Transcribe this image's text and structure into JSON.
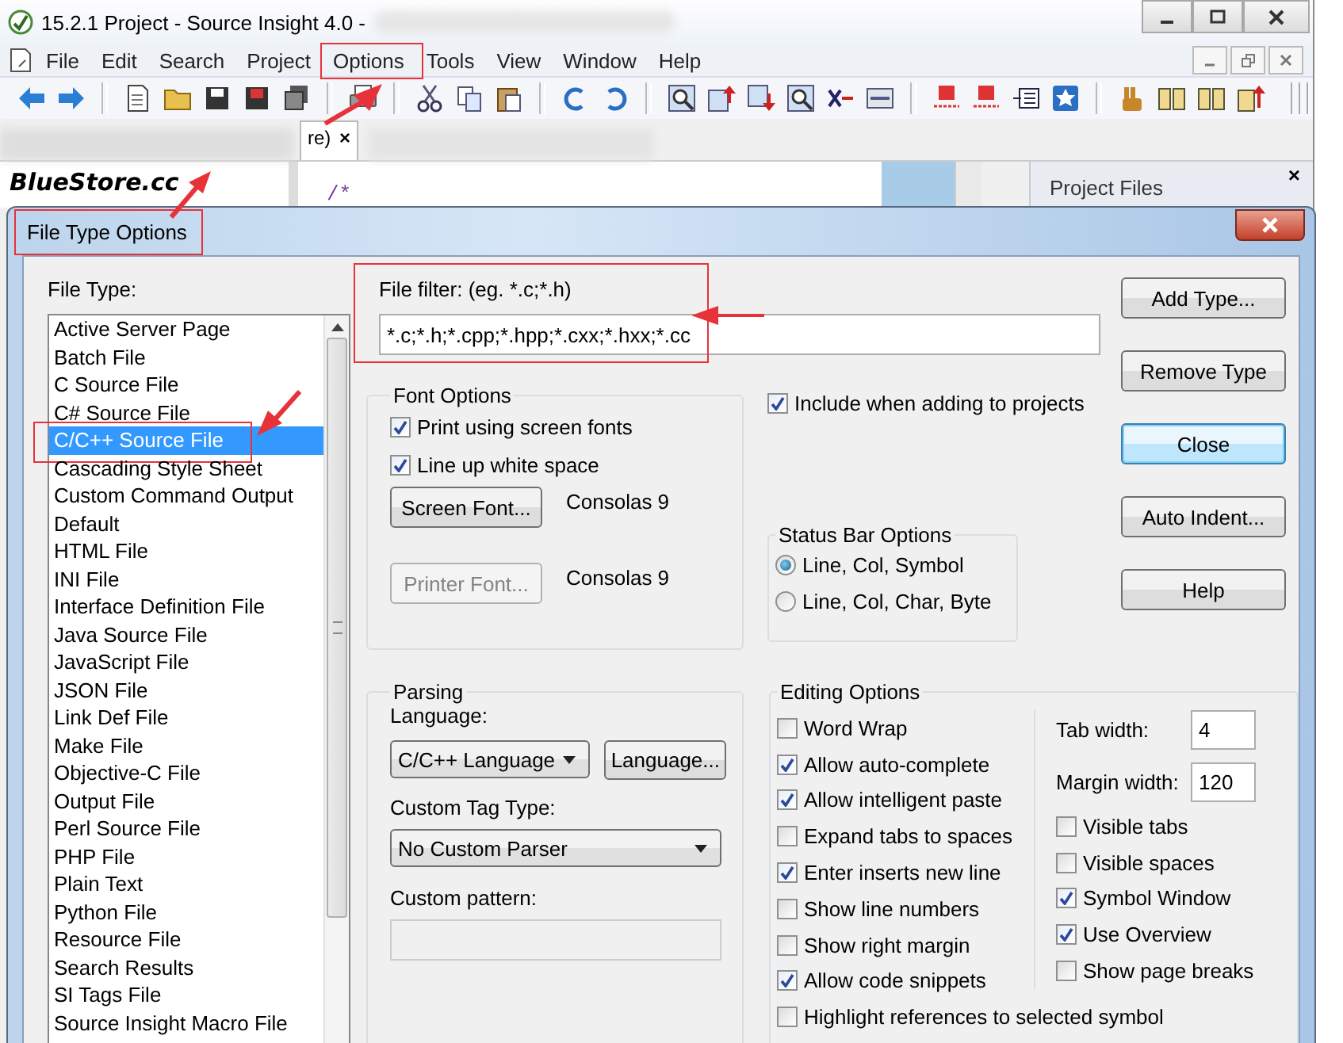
{
  "window": {
    "title": "15.2.1 Project - Source Insight 4.0 -"
  },
  "menu": [
    {
      "label": "File",
      "highlighted": false
    },
    {
      "label": "Edit",
      "highlighted": false
    },
    {
      "label": "Search",
      "highlighted": false
    },
    {
      "label": "Project",
      "highlighted": false
    },
    {
      "label": "Options",
      "highlighted": true
    },
    {
      "label": "Tools",
      "highlighted": false
    },
    {
      "label": "View",
      "highlighted": false
    },
    {
      "label": "Window",
      "highlighted": false
    },
    {
      "label": "Help",
      "highlighted": false
    }
  ],
  "editor_tab": {
    "label": "re)",
    "close": "×"
  },
  "symbol_panel": {
    "title": "BlueStore.cc"
  },
  "editor": {
    "code": "/*"
  },
  "project_panel": {
    "title": "Project Files",
    "close": "×"
  },
  "dialog": {
    "title": "File Type Options",
    "title_highlighted": true,
    "file_type": {
      "label": "File Type:",
      "items": [
        {
          "label": "Active Server Page",
          "selected": false,
          "highlighted": false
        },
        {
          "label": "Batch File",
          "selected": false,
          "highlighted": false
        },
        {
          "label": "C Source File",
          "selected": false,
          "highlighted": false
        },
        {
          "label": "C# Source File",
          "selected": false,
          "highlighted": false
        },
        {
          "label": "C/C++ Source File",
          "selected": true,
          "highlighted": true
        },
        {
          "label": "Cascading Style Sheet",
          "selected": false,
          "highlighted": false
        },
        {
          "label": "Custom Command Output",
          "selected": false,
          "highlighted": false
        },
        {
          "label": "Default",
          "selected": false,
          "highlighted": false
        },
        {
          "label": "HTML File",
          "selected": false,
          "highlighted": false
        },
        {
          "label": "INI File",
          "selected": false,
          "highlighted": false
        },
        {
          "label": "Interface Definition File",
          "selected": false,
          "highlighted": false
        },
        {
          "label": "Java Source File",
          "selected": false,
          "highlighted": false
        },
        {
          "label": "JavaScript File",
          "selected": false,
          "highlighted": false
        },
        {
          "label": "JSON File",
          "selected": false,
          "highlighted": false
        },
        {
          "label": "Link Def File",
          "selected": false,
          "highlighted": false
        },
        {
          "label": "Make File",
          "selected": false,
          "highlighted": false
        },
        {
          "label": "Objective-C File",
          "selected": false,
          "highlighted": false
        },
        {
          "label": "Output File",
          "selected": false,
          "highlighted": false
        },
        {
          "label": "Perl Source File",
          "selected": false,
          "highlighted": false
        },
        {
          "label": "PHP File",
          "selected": false,
          "highlighted": false
        },
        {
          "label": "Plain Text",
          "selected": false,
          "highlighted": false
        },
        {
          "label": "Python File",
          "selected": false,
          "highlighted": false
        },
        {
          "label": "Resource File",
          "selected": false,
          "highlighted": false
        },
        {
          "label": "Search Results",
          "selected": false,
          "highlighted": false
        },
        {
          "label": "SI Tags File",
          "selected": false,
          "highlighted": false
        },
        {
          "label": "Source Insight Macro File",
          "selected": false,
          "highlighted": false
        }
      ]
    },
    "file_filter": {
      "label": "File filter: (eg. *.c;*.h)",
      "value": "*.c;*.h;*.cpp;*.hpp;*.cxx;*.hxx;*.cc",
      "highlighted": true
    },
    "font_options": {
      "title": "Font Options",
      "checkboxes": [
        {
          "label": "Print using screen fonts",
          "checked": true
        },
        {
          "label": "Line up white space",
          "checked": true
        }
      ],
      "fonts": [
        {
          "button": "Screen Font...",
          "disabled": false,
          "value": "Consolas 9"
        },
        {
          "button": "Printer Font...",
          "disabled": true,
          "value": "Consolas 9"
        }
      ]
    },
    "include_in_projects": {
      "label": "Include when adding to projects",
      "checked": true
    },
    "status_bar_options": {
      "title": "Status Bar Options",
      "radios": [
        {
          "label": "Line, Col, Symbol",
          "selected": true
        },
        {
          "label": "Line, Col, Char, Byte",
          "selected": false
        }
      ]
    },
    "buttons": [
      {
        "label": "Add Type...",
        "default": false
      },
      {
        "label": "Remove Type",
        "default": false
      },
      {
        "label": "Close",
        "default": true
      },
      {
        "label": "Auto Indent...",
        "default": false
      },
      {
        "label": "Help",
        "default": false
      }
    ],
    "parsing": {
      "title": "Parsing",
      "language_label": "Language:",
      "language": "C/C++ Language",
      "language_button": "Language...",
      "tag_label": "Custom Tag Type:",
      "tag": "No Custom Parser",
      "pattern_label": "Custom pattern:"
    },
    "editing_options": {
      "title": "Editing Options",
      "checkboxes": [
        {
          "label": "Word Wrap",
          "checked": false
        },
        {
          "label": "Allow auto-complete",
          "checked": true
        },
        {
          "label": "Allow intelligent paste",
          "checked": true
        },
        {
          "label": "Expand tabs to spaces",
          "checked": false
        },
        {
          "label": "Enter inserts new line",
          "checked": true
        },
        {
          "label": "Show line numbers",
          "checked": false
        },
        {
          "label": "Show right margin",
          "checked": false
        },
        {
          "label": "Allow code snippets",
          "checked": true
        },
        {
          "label": "Highlight references to selected symbol",
          "checked": false
        }
      ],
      "tab_width": {
        "label": "Tab width:",
        "value": "4"
      },
      "margin_width": {
        "label": "Margin width:",
        "value": "120"
      },
      "right_checkboxes": [
        {
          "label": "Visible tabs",
          "checked": false
        },
        {
          "label": "Visible spaces",
          "checked": false
        },
        {
          "label": "Symbol Window",
          "checked": true
        },
        {
          "label": "Use Overview",
          "checked": true
        },
        {
          "label": "Show page breaks",
          "checked": false
        }
      ]
    }
  }
}
